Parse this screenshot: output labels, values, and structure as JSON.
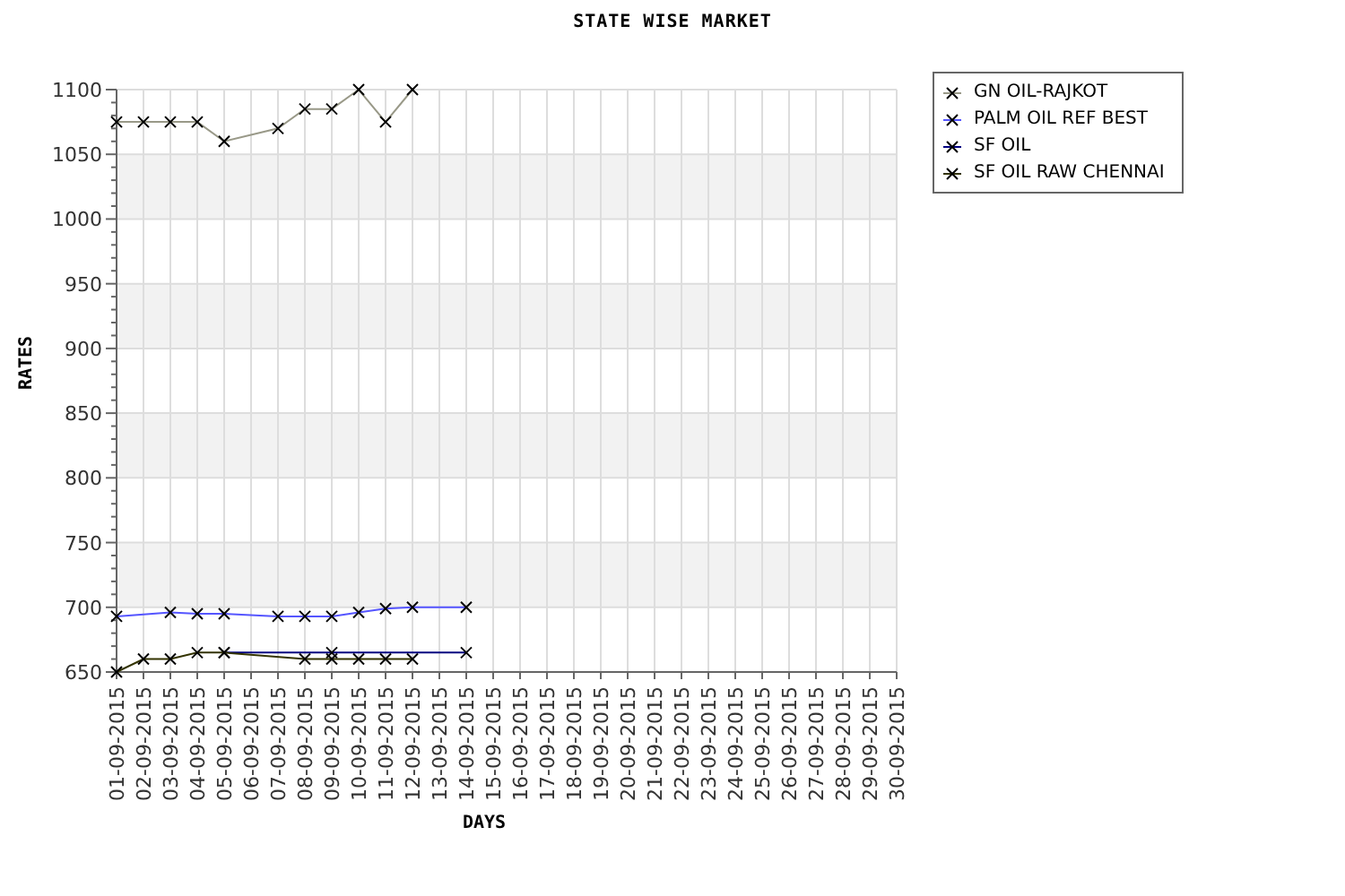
{
  "chart_data": {
    "type": "line",
    "title": "STATE WISE MARKET",
    "xlabel": "DAYS",
    "ylabel": "RATES",
    "categories": [
      "01-09-2015",
      "02-09-2015",
      "03-09-2015",
      "04-09-2015",
      "05-09-2015",
      "06-09-2015",
      "07-09-2015",
      "08-09-2015",
      "09-09-2015",
      "10-09-2015",
      "11-09-2015",
      "12-09-2015",
      "13-09-2015",
      "14-09-2015",
      "15-09-2015",
      "16-09-2015",
      "17-09-2015",
      "18-09-2015",
      "19-09-2015",
      "20-09-2015",
      "21-09-2015",
      "22-09-2015",
      "23-09-2015",
      "24-09-2015",
      "25-09-2015",
      "26-09-2015",
      "27-09-2015",
      "28-09-2015",
      "29-09-2015",
      "30-09-2015"
    ],
    "grid": true,
    "ylim": [
      650,
      1100
    ],
    "yticks": [
      650,
      700,
      750,
      800,
      850,
      900,
      950,
      1000,
      1050,
      1100
    ],
    "series": [
      {
        "name": "GN OIL-RAJKOT",
        "color": "#999988",
        "marker": "x",
        "values": [
          1075,
          1075,
          1075,
          1075,
          1060,
          null,
          1070,
          1085,
          1085,
          1100,
          1075,
          1100,
          null,
          null,
          null,
          null,
          null,
          null,
          null,
          null,
          null,
          null,
          null,
          null,
          null,
          null,
          null,
          null,
          null,
          null
        ]
      },
      {
        "name": "PALM OIL REF BEST",
        "color": "#5555ff",
        "marker": "x",
        "values": [
          693,
          null,
          696,
          695,
          695,
          null,
          693,
          693,
          693,
          696,
          699,
          700,
          null,
          700,
          null,
          null,
          null,
          null,
          null,
          null,
          null,
          null,
          null,
          null,
          null,
          null,
          null,
          null,
          null,
          null
        ]
      },
      {
        "name": "SF OIL",
        "color": "#000080",
        "marker": "x",
        "values": [
          null,
          null,
          null,
          null,
          665,
          null,
          null,
          null,
          665,
          null,
          null,
          null,
          null,
          665,
          null,
          null,
          null,
          null,
          null,
          null,
          null,
          null,
          null,
          null,
          null,
          null,
          null,
          null,
          null,
          null
        ]
      },
      {
        "name": "SF OIL RAW CHENNAI",
        "color": "#333300",
        "marker": "x",
        "values": [
          650,
          660,
          660,
          665,
          665,
          null,
          null,
          660,
          660,
          660,
          660,
          660,
          null,
          null,
          null,
          null,
          null,
          null,
          null,
          null,
          null,
          null,
          null,
          null,
          null,
          null,
          null,
          null,
          null,
          null
        ]
      }
    ]
  }
}
